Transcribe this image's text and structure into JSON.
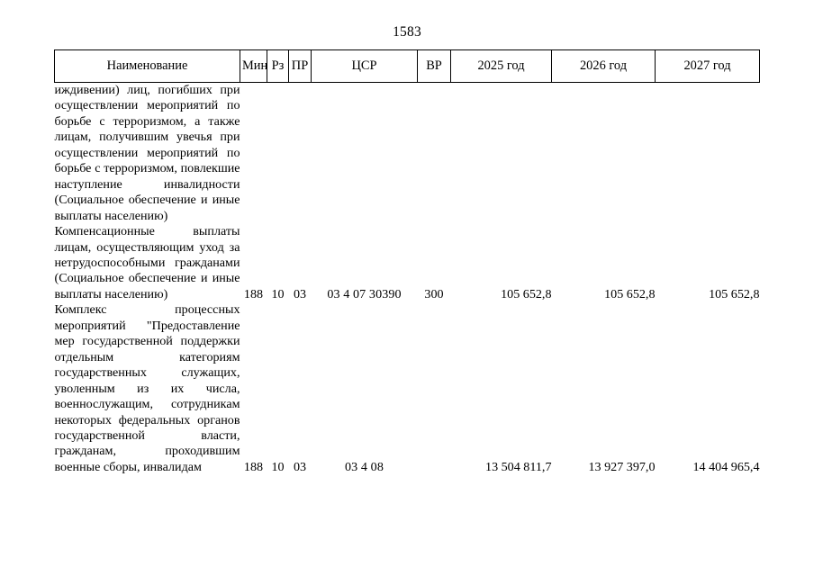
{
  "page": {
    "number": "1583"
  },
  "table": {
    "headers": [
      {
        "key": "name",
        "label": "Наименование"
      },
      {
        "key": "min",
        "label": "Мин"
      },
      {
        "key": "rz",
        "label": "Рз"
      },
      {
        "key": "pr",
        "label": "ПР"
      },
      {
        "key": "csr",
        "label": "ЦСР"
      },
      {
        "key": "vr",
        "label": "ВР"
      },
      {
        "key": "y2025",
        "label": "2025 год"
      },
      {
        "key": "y2026",
        "label": "2026 год"
      },
      {
        "key": "y2027",
        "label": "2027 год"
      }
    ],
    "rows": [
      {
        "id": "row-terrorism-disability",
        "name": "иждивении) лиц, погибших при осуществлении мероприятий по борьбе с терроризмом, а также лицам, получившим увечья при осуществлении мероприятий по борьбе с терроризмом, повлекшие наступление инвалидности (Социальное обеспечение и иные выплаты населению)",
        "min": "",
        "rz": "",
        "pr": "",
        "csr": "",
        "vr": "",
        "y2025": "",
        "y2026": "",
        "y2027": ""
      },
      {
        "id": "row-compensation-care",
        "name": "Компенсационные выплаты лицам, осуществляющим уход за нетрудоспособными гражданами (Социальное обеспечение и иные выплаты населению)",
        "min": "188",
        "rz": "10",
        "pr": "03",
        "csr": "03 4 07 30390",
        "vr": "300",
        "y2025": "105 652,8",
        "y2026": "105 652,8",
        "y2027": "105 652,8"
      },
      {
        "id": "row-process-complex-support",
        "name": "Комплекс процессных мероприятий \"Предоставление мер государственной поддержки отдельным категориям государственных служащих, уволенным из их числа, военнослужащим, сотрудникам некоторых федеральных органов государственной власти, гражданам, проходившим военные сборы, инвалидам",
        "min": "188",
        "rz": "10",
        "pr": "03",
        "csr": "03 4 08",
        "vr": "",
        "y2025": "13 504 811,7",
        "y2026": "13 927 397,0",
        "y2027": "14 404 965,4"
      }
    ]
  }
}
